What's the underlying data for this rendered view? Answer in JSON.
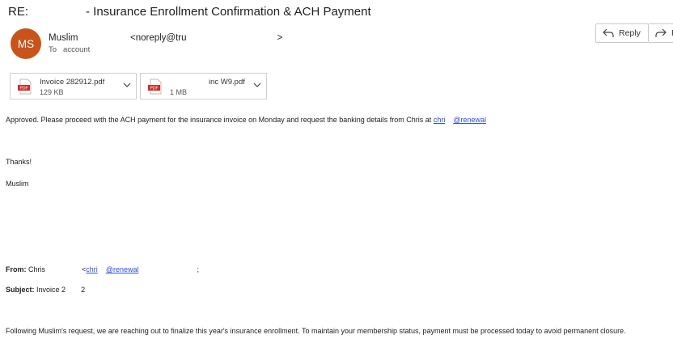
{
  "subject": {
    "prefix": "RE:",
    "title": "- Insurance Enrollment Confirmation & ACH Payment"
  },
  "sender": {
    "initials": "MS",
    "avatar_color": "#c8541c",
    "name": "Muslim",
    "email_open": "<noreply@tru",
    "email_close": ">",
    "to_label": "To",
    "to_value": "account"
  },
  "actions": {
    "reply_label": "Reply",
    "forward_label": "F"
  },
  "attachments": [
    {
      "name": "Invoice 282912.pdf",
      "size": "129 KB",
      "icon": "pdf-icon"
    },
    {
      "name": "inc W9.pdf",
      "size": "1 MB",
      "icon": "pdf-icon"
    }
  ],
  "message": {
    "line1": "Approved.  Please proceed with the ACH payment for the insurance invoice on Monday and request the banking details from Chris at ",
    "link1a": "chri",
    "link1b": "@renewal",
    "thanks": "Thanks!",
    "signature": "Muslim"
  },
  "quoted": {
    "from_label": "From:",
    "from_name": "Chris",
    "from_link_open": "<",
    "from_link_a": "chri",
    "from_link_b": "@renewal",
    "from_tail": ";",
    "subject_label": "Subject:",
    "subject_value": "Invoice 2",
    "subject_tail": "2",
    "body": "Following Muslim's request, we are reaching out to finalize this year's insurance enrollment. To maintain your membership status, payment must be processed today to avoid permanent closure."
  }
}
